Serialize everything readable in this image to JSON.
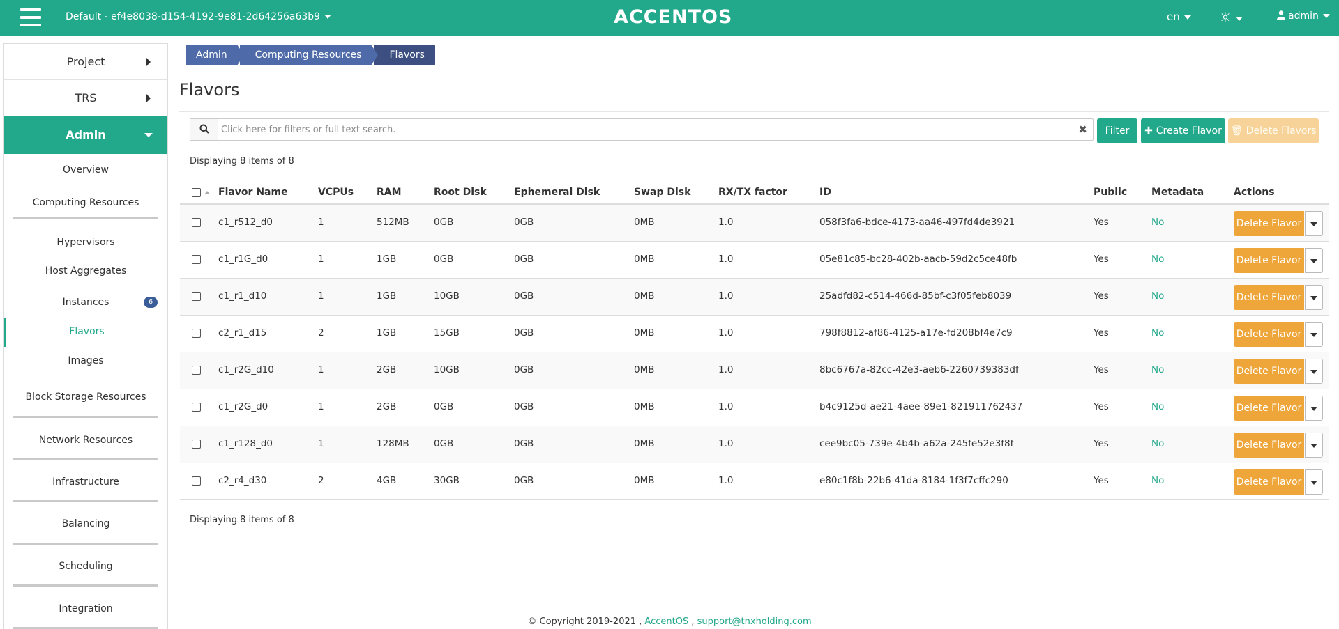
{
  "header": {
    "project": "Default - ef4e8038-d154-4192-9e81-2d64256a63b9",
    "logo": "ACCENTOS",
    "lang": "en",
    "user": "admin"
  },
  "sidebar": {
    "project": "Project",
    "trs": "TRS",
    "admin": "Admin",
    "items": [
      {
        "label": "Overview"
      },
      {
        "label": "Computing Resources"
      },
      {
        "label": "Hypervisors"
      },
      {
        "label": "Host Aggregates"
      },
      {
        "label": "Instances",
        "badge": "6"
      },
      {
        "label": "Flavors"
      },
      {
        "label": "Images"
      },
      {
        "label": "Block Storage Resources"
      },
      {
        "label": "Network Resources"
      },
      {
        "label": "Infrastructure"
      },
      {
        "label": "Balancing"
      },
      {
        "label": "Scheduling"
      },
      {
        "label": "Integration"
      }
    ]
  },
  "breadcrumb": [
    "Admin",
    "Computing Resources",
    "Flavors"
  ],
  "page": {
    "title": "Flavors",
    "search_placeholder": "Click here for filters or full text search.",
    "filter_label": "Filter",
    "create_label": "Create Flavor",
    "delete_all_label": "Delete Flavors",
    "count_top": "Displaying 8 items of 8",
    "count_bottom": "Displaying 8 items of 8"
  },
  "table": {
    "columns": [
      "Flavor Name",
      "VCPUs",
      "RAM",
      "Root Disk",
      "Ephemeral Disk",
      "Swap Disk",
      "RX/TX factor",
      "ID",
      "Public",
      "Metadata",
      "Actions"
    ],
    "action_label": "Delete Flavor",
    "rows": [
      {
        "name": "c1_r512_d0",
        "vcpus": "1",
        "ram": "512MB",
        "root": "0GB",
        "eph": "0GB",
        "swap": "0MB",
        "rxtx": "1.0",
        "id": "058f3fa6-bdce-4173-aa46-497fd4de3921",
        "public": "Yes",
        "meta": "No"
      },
      {
        "name": "c1_r1G_d0",
        "vcpus": "1",
        "ram": "1GB",
        "root": "0GB",
        "eph": "0GB",
        "swap": "0MB",
        "rxtx": "1.0",
        "id": "05e81c85-bc28-402b-aacb-59d2c5ce48fb",
        "public": "Yes",
        "meta": "No"
      },
      {
        "name": "c1_r1_d10",
        "vcpus": "1",
        "ram": "1GB",
        "root": "10GB",
        "eph": "0GB",
        "swap": "0MB",
        "rxtx": "1.0",
        "id": "25adfd82-c514-466d-85bf-c3f05feb8039",
        "public": "Yes",
        "meta": "No"
      },
      {
        "name": "c2_r1_d15",
        "vcpus": "2",
        "ram": "1GB",
        "root": "15GB",
        "eph": "0GB",
        "swap": "0MB",
        "rxtx": "1.0",
        "id": "798f8812-af86-4125-a17e-fd208bf4e7c9",
        "public": "Yes",
        "meta": "No"
      },
      {
        "name": "c1_r2G_d10",
        "vcpus": "1",
        "ram": "2GB",
        "root": "10GB",
        "eph": "0GB",
        "swap": "0MB",
        "rxtx": "1.0",
        "id": "8bc6767a-82cc-42e3-aeb6-2260739383df",
        "public": "Yes",
        "meta": "No"
      },
      {
        "name": "c1_r2G_d0",
        "vcpus": "1",
        "ram": "2GB",
        "root": "0GB",
        "eph": "0GB",
        "swap": "0MB",
        "rxtx": "1.0",
        "id": "b4c9125d-ae21-4aee-89e1-821911762437",
        "public": "Yes",
        "meta": "No"
      },
      {
        "name": "c1_r128_d0",
        "vcpus": "1",
        "ram": "128MB",
        "root": "0GB",
        "eph": "0GB",
        "swap": "0MB",
        "rxtx": "1.0",
        "id": "cee9bc05-739e-4b4b-a62a-245fe52e3f8f",
        "public": "Yes",
        "meta": "No"
      },
      {
        "name": "c2_r4_d30",
        "vcpus": "2",
        "ram": "4GB",
        "root": "30GB",
        "eph": "0GB",
        "swap": "0MB",
        "rxtx": "1.0",
        "id": "e80c1f8b-22b6-41da-8184-1f3f7cffc290",
        "public": "Yes",
        "meta": "No"
      }
    ]
  },
  "footer": {
    "copyright": "© Copyright 2019-2021 ,",
    "brand": "AccentOS",
    "sep": ",",
    "email": "support@tnxholding.com"
  },
  "colors": {
    "primary": "#22a88a",
    "warning": "#eea63a",
    "breadcrumb": "#4e6aa8"
  }
}
